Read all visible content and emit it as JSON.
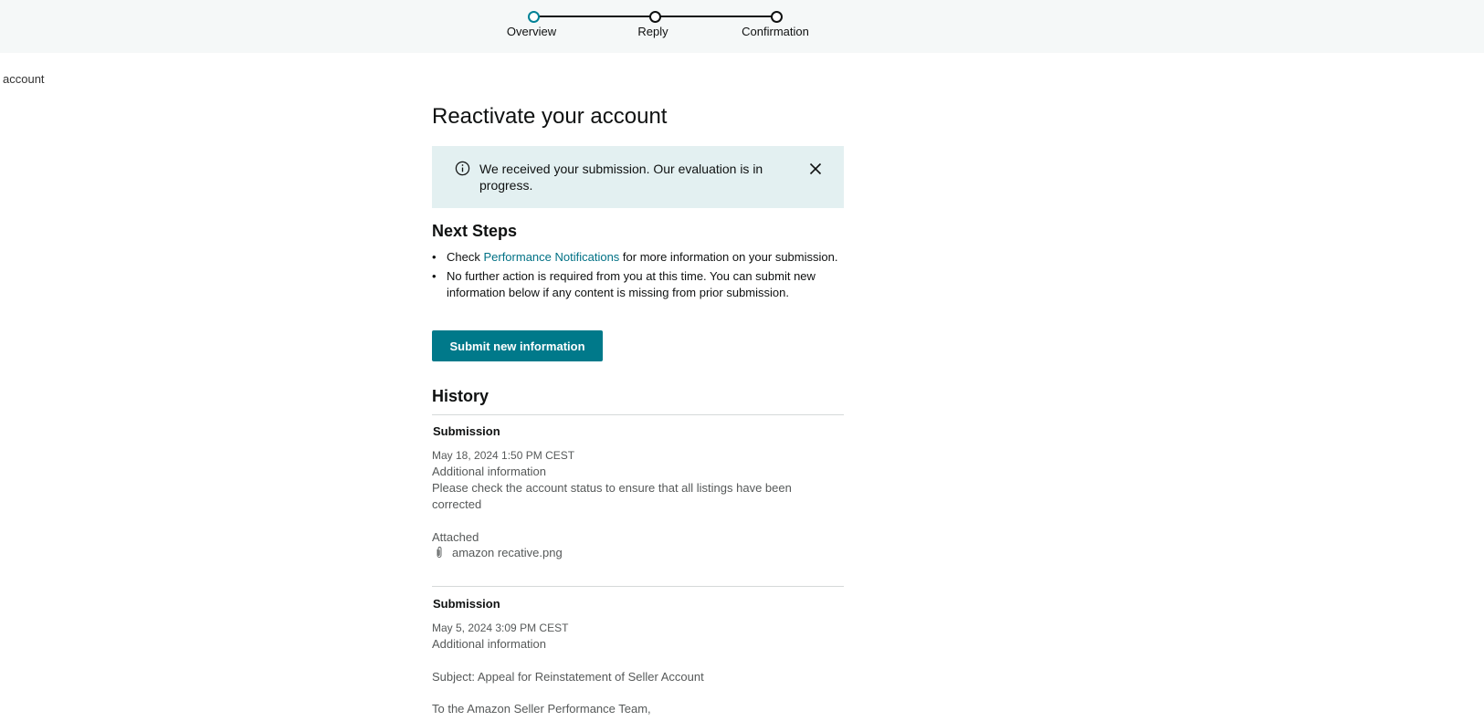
{
  "stepper": {
    "steps": [
      {
        "label": "Overview",
        "active": true
      },
      {
        "label": "Reply",
        "active": false
      },
      {
        "label": "Confirmation",
        "active": false
      }
    ]
  },
  "breadcrumb": "account",
  "page": {
    "title": "Reactivate your account"
  },
  "alert": {
    "icon": "info-icon",
    "text": "We received your submission. Our evaluation is in progress.",
    "close_icon": "close-icon"
  },
  "next_steps": {
    "heading": "Next Steps",
    "item1_prefix": "Check ",
    "item1_link": "Performance Notifications",
    "item1_suffix": " for more information on your submission.",
    "item2": "No further action is required from you at this time. You can submit new information below if any content is missing from prior submission."
  },
  "submit_button": "Submit new information",
  "history": {
    "heading": "History",
    "submissions": [
      {
        "title": "Submission",
        "date": "May 18, 2024 1:50 PM CEST",
        "type": "Additional information",
        "body": "Please check the account status to ensure that all listings have been corrected",
        "attached_label": "Attached",
        "attachment": "amazon recative.png"
      },
      {
        "title": "Submission",
        "date": "May 5, 2024 3:09 PM CEST",
        "type": "Additional information",
        "subject": "Subject: Appeal for Reinstatement of Seller Account",
        "greeting": "To the Amazon Seller Performance Team,"
      }
    ]
  },
  "colors": {
    "accent": "#008296",
    "button": "#00798a",
    "alert_bg": "#e3f0f1",
    "link": "#007185"
  }
}
